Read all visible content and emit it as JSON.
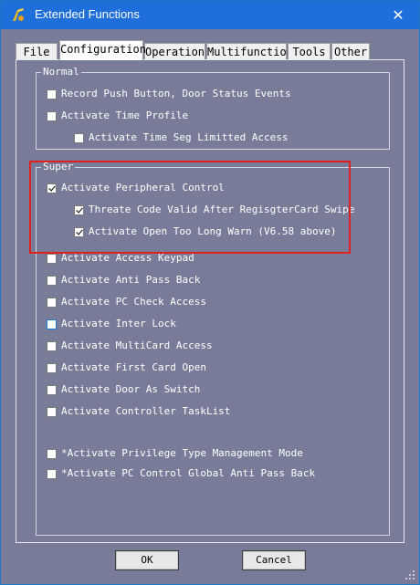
{
  "window": {
    "title": "Extended Functions",
    "close_glyph": "✕"
  },
  "tabs": [
    {
      "label": "File"
    },
    {
      "label": "Configuration"
    },
    {
      "label": "Operation"
    },
    {
      "label": "Multifunction"
    },
    {
      "label": "Tools"
    },
    {
      "label": "Other"
    }
  ],
  "active_tab": "Configuration",
  "groups": {
    "normal": {
      "label": "Normal",
      "options": [
        {
          "label": "Record Push Button, Door Status Events",
          "checked": false
        },
        {
          "label": "Activate Time Profile",
          "checked": false
        },
        {
          "label": "Activate Time Seg Limitted Access",
          "checked": false
        }
      ]
    },
    "super": {
      "label": "Super",
      "options": [
        {
          "label": "Activate Peripheral Control",
          "checked": true
        },
        {
          "label": "Threate Code Valid After RegisgterCard Swipe",
          "checked": true
        },
        {
          "label": "Activate Open Too Long Warn (V6.58 above)",
          "checked": true
        },
        {
          "label": "Activate Access Keypad",
          "checked": false
        },
        {
          "label": "Activate Anti Pass Back",
          "checked": false
        },
        {
          "label": "Activate PC Check Access",
          "checked": false
        },
        {
          "label": "Activate Inter Lock",
          "checked": false
        },
        {
          "label": "Activate MultiCard Access",
          "checked": false
        },
        {
          "label": "Activate First Card Open",
          "checked": false
        },
        {
          "label": "Activate Door As Switch",
          "checked": false
        },
        {
          "label": "Activate Controller TaskList",
          "checked": false
        },
        {
          "label": "*Activate Privilege Type Management Mode",
          "checked": false
        },
        {
          "label": "*Activate PC Control Global Anti Pass Back",
          "checked": false
        }
      ]
    }
  },
  "buttons": {
    "ok": "OK",
    "cancel": "Cancel"
  },
  "colors": {
    "titlebar": "#1e6fd9",
    "background": "#787c98",
    "highlight_border": "#e02020"
  },
  "icons": {
    "app": "key-figure-icon",
    "close": "close-icon",
    "resize": "resize-grip-icon"
  }
}
